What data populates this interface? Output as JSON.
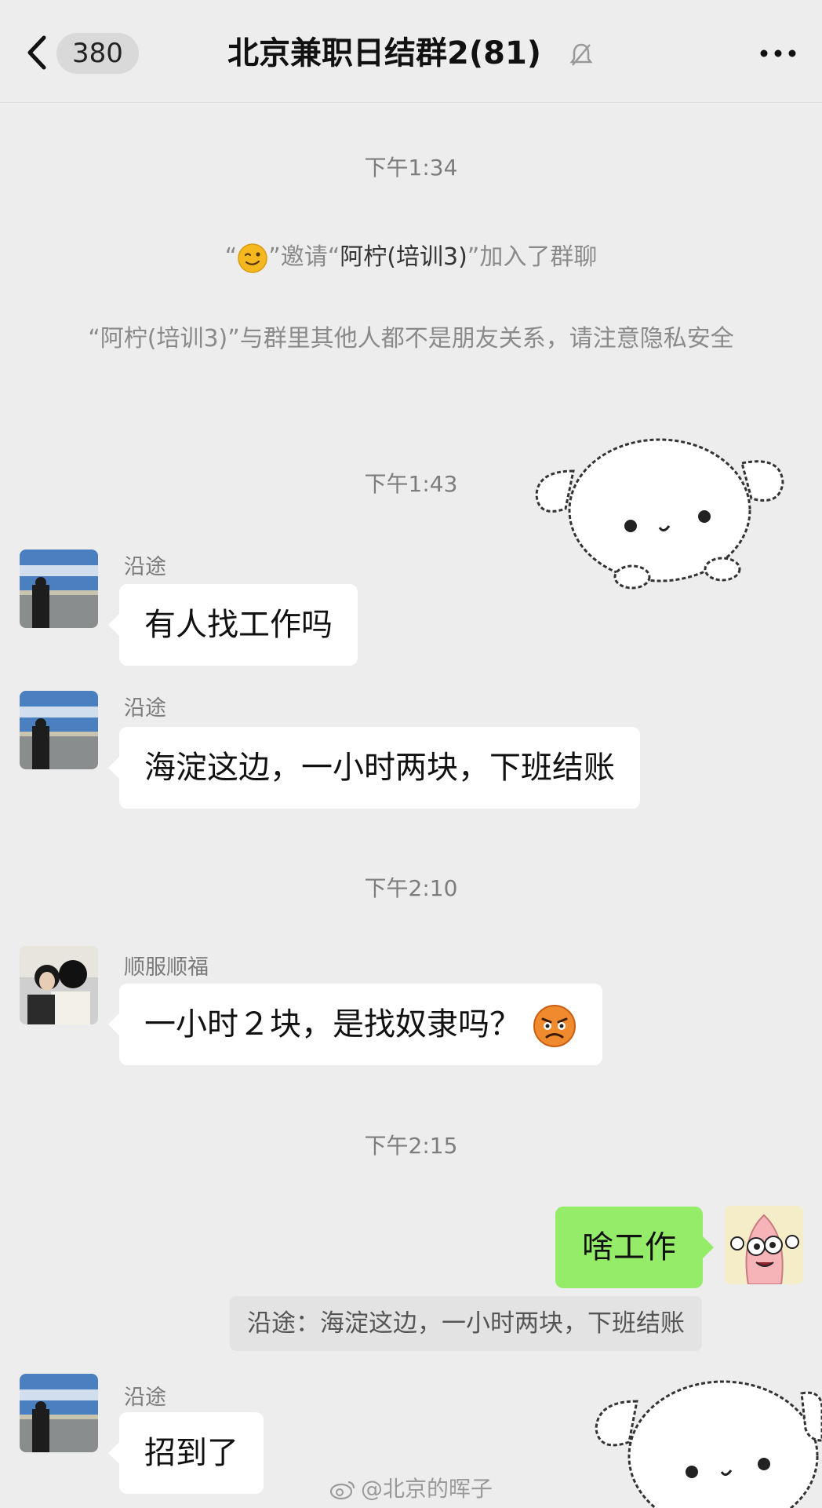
{
  "header": {
    "unread_count": "380",
    "title": "北京兼职日结群2(81)"
  },
  "messages": {
    "time1": "下午1:34",
    "invite": {
      "q1": "“",
      "q2": "”邀请“",
      "name": "阿柠(培训3)",
      "tail": "”加入了群聊"
    },
    "privacy_notice": "“阿柠(培训3)”与群里其他人都不是朋友关系，请注意隐私安全",
    "time2": "下午1:43",
    "m1": {
      "sender": "沿途",
      "text": "有人找工作吗"
    },
    "m2": {
      "sender": "沿途",
      "text": "海淀这边，一小时两块，下班结账"
    },
    "time3": "下午2:10",
    "m3": {
      "sender": "顺服顺福",
      "text": "一小时２块，是找奴隶吗？"
    },
    "time4": "下午2:15",
    "m4": {
      "text": "啥工作"
    },
    "m4_quote": "沿途：海淀这边，一小时两块，下班结账",
    "m5": {
      "sender": "沿途",
      "text": "招到了"
    }
  },
  "watermark": "@北京的晖子",
  "colors": {
    "background": "#ededed",
    "bubble_other": "#ffffff",
    "bubble_self": "#95ec69"
  },
  "icons": [
    "chevron-left-icon",
    "mute-bell-icon",
    "more-icon",
    "wink-emoji-icon",
    "angry-emoji-icon",
    "weibo-logo-icon"
  ]
}
